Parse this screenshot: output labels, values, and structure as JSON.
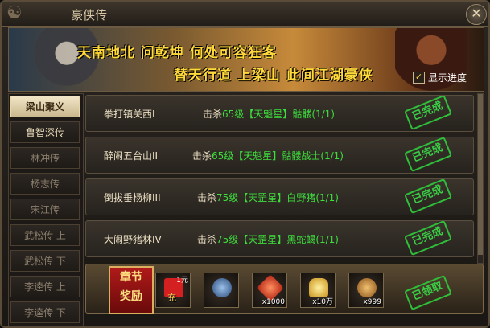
{
  "window": {
    "title": "豪侠传",
    "close": "✕"
  },
  "banner": {
    "line1": "天南地北 问乾坤 何处可容狂客",
    "line2": "替天行道 上梁山 此间江湖豪侠",
    "show_progress_label": "显示进度",
    "show_progress_checked": true
  },
  "sidebar": {
    "items": [
      {
        "label": "梁山聚义",
        "state": "selected"
      },
      {
        "label": "鲁智深传",
        "state": "active"
      },
      {
        "label": "林冲传",
        "state": "normal"
      },
      {
        "label": "杨志传",
        "state": "normal"
      },
      {
        "label": "宋江传",
        "state": "normal"
      },
      {
        "label": "武松传 上",
        "state": "normal"
      },
      {
        "label": "武松传 下",
        "state": "normal"
      },
      {
        "label": "李逵传 上",
        "state": "normal"
      },
      {
        "label": "李逵传 下",
        "state": "normal"
      }
    ]
  },
  "quests": [
    {
      "name": "拳打镇关西I",
      "prefix": "击杀",
      "level": "65级",
      "star": "【天魁星】",
      "target": "骷髅(1/1)",
      "status": "已完成"
    },
    {
      "name": "醉闹五台山II",
      "prefix": "击杀",
      "level": "65级",
      "star": "【天魁星】",
      "target": "骷髅战士(1/1)",
      "status": "已完成"
    },
    {
      "name": "倒拔垂杨柳III",
      "prefix": "击杀",
      "level": "75级",
      "star": "【天罡星】",
      "target": "白野猪(1/1)",
      "status": "已完成"
    },
    {
      "name": "大闹野猪林IV",
      "prefix": "击杀",
      "level": "75级",
      "star": "【天罡星】",
      "target": "黑蛇蝎(1/1)",
      "status": "已完成"
    }
  ],
  "reward": {
    "badge_line1": "章节",
    "badge_line2": "奖励",
    "items": [
      {
        "icon": "red-envelope-icon",
        "tag": "1元",
        "label": "充",
        "count": "",
        "color": "#d42020"
      },
      {
        "icon": "dragon-orb-icon",
        "tag": "",
        "label": "",
        "count": "",
        "color": "#3a5a8a"
      },
      {
        "icon": "red-gem-icon",
        "tag": "",
        "label": "",
        "count": "x1000",
        "color": "#e05020"
      },
      {
        "icon": "gold-ingot-icon",
        "tag": "",
        "label": "",
        "count": "x10万",
        "color": "#e8b830"
      },
      {
        "icon": "bronze-ore-icon",
        "tag": "",
        "label": "",
        "count": "x999",
        "color": "#c88a30"
      }
    ],
    "claim_label": "已领取"
  }
}
